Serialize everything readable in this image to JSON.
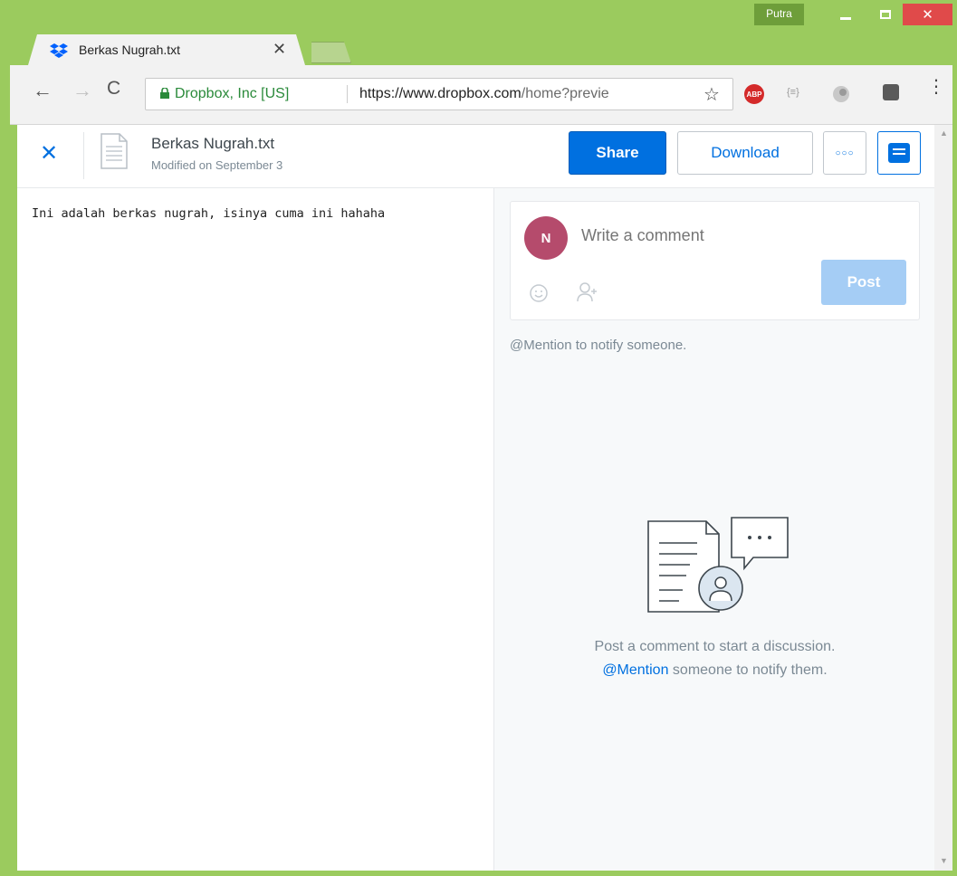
{
  "window": {
    "profile_name": "Putra",
    "close_glyph": "✕"
  },
  "tab": {
    "title": "Berkas Nugrah.txt",
    "close_glyph": "✕",
    "icon": "dropbox-icon"
  },
  "toolbar": {
    "back_glyph": "←",
    "forward_glyph": "→",
    "reload_glyph": "C",
    "site_identity": "Dropbox, Inc [US]",
    "url_origin": "https://www.dropbox.com",
    "url_path": "/home?previe",
    "star_glyph": "☆",
    "abp_label": "ABP",
    "json_label": "{≡}",
    "menu_glyph": "⋮"
  },
  "viewer": {
    "close_glyph": "✕",
    "file_name": "Berkas Nugrah.txt",
    "file_meta": "Modified on September 3",
    "share_label": "Share",
    "download_label": "Download",
    "more_label": "○○○"
  },
  "document": {
    "text": "Ini adalah berkas nugrah, isinya cuma ini hahaha"
  },
  "comments": {
    "avatar_initial": "N",
    "input_placeholder": "Write a comment",
    "post_label": "Post",
    "mention_hint": "@Mention to notify someone.",
    "empty_line1": "Post a comment to start a discussion.",
    "empty_mention": "@Mention",
    "empty_line2_rest": " someone to notify them."
  },
  "colors": {
    "accent": "#0070e0",
    "frame": "#9bcb5e",
    "avatar": "#b54b6c",
    "post_disabled": "#a5cdf5"
  },
  "scrollbar": {
    "up_glyph": "▲",
    "down_glyph": "▼"
  }
}
